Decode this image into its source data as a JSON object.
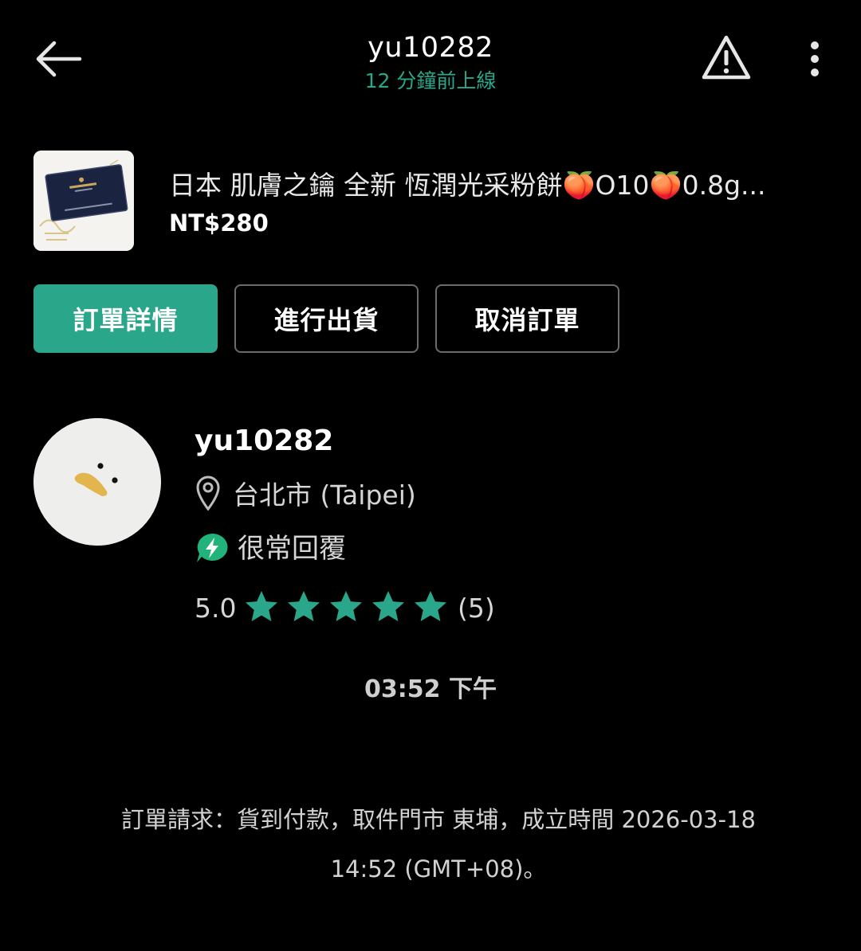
{
  "header": {
    "title": "yu10282",
    "subtitle": "12 分鐘前上線",
    "back_icon": "arrow-left-icon",
    "warn_icon": "warning-triangle-icon",
    "more_icon": "more-vertical-icon"
  },
  "product": {
    "title": "日本 肌膚之鑰 全新 恆潤光采粉餅🍑O10🍑0.8g...",
    "price": "NT$280"
  },
  "actions": {
    "details_label": "訂單詳情",
    "ship_label": "進行出貨",
    "cancel_label": "取消訂單"
  },
  "seller": {
    "name": "yu10282",
    "location": "台北市 (Taipei)",
    "response": "很常回覆",
    "rating_value": "5.0",
    "rating_stars": 5,
    "rating_count": "(5)"
  },
  "chat": {
    "time": "03:52 下午",
    "system_message": "訂單請求：貨到付款，取件門市 東埔，成立時間 2026-03-18 14:52 (GMT+08)。"
  },
  "colors": {
    "accent": "#2aa68b",
    "background": "#000000"
  }
}
